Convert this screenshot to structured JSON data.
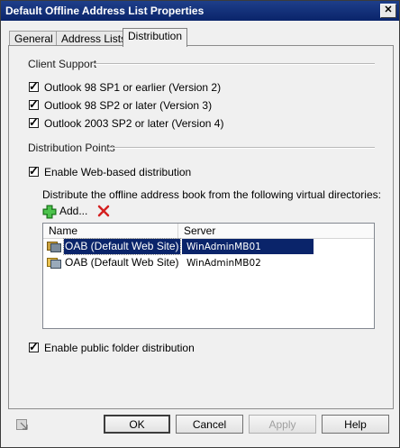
{
  "window": {
    "title": "Default Offline Address List Properties"
  },
  "tabs": [
    {
      "label": "General"
    },
    {
      "label": "Address Lists"
    },
    {
      "label": "Distribution"
    }
  ],
  "client_support": {
    "heading": "Client Support",
    "options": [
      {
        "label": "Outlook 98 SP1 or earlier (Version 2)",
        "checked": true
      },
      {
        "label": "Outlook 98 SP2 or later (Version 3)",
        "checked": true
      },
      {
        "label": "Outlook 2003 SP2 or later (Version 4)",
        "checked": true
      }
    ]
  },
  "distribution_points": {
    "heading": "Distribution Points",
    "web_based": {
      "label": "Enable Web-based distribution",
      "checked": true
    },
    "description": "Distribute the offline address book from the following virtual directories:",
    "add_label": "Add...",
    "columns": [
      "Name",
      "Server"
    ],
    "rows": [
      {
        "name": "OAB (Default Web Site)",
        "server": "WinAdminMB01",
        "selected": true
      },
      {
        "name": "OAB (Default Web Site)",
        "server": "WinAdminMB02",
        "selected": false
      }
    ],
    "public_folder": {
      "label": "Enable public folder distribution",
      "checked": true
    }
  },
  "buttons": {
    "ok": "OK",
    "cancel": "Cancel",
    "apply": "Apply",
    "help": "Help"
  },
  "colors": {
    "title_bar": "#0a246a",
    "selection": "#0a246a",
    "add_icon": "#2ea12e",
    "delete_icon": "#d42020"
  },
  "icons": [
    "close-icon",
    "add-icon",
    "delete-icon",
    "virtual-directory-icon",
    "properties-status-icon"
  ]
}
